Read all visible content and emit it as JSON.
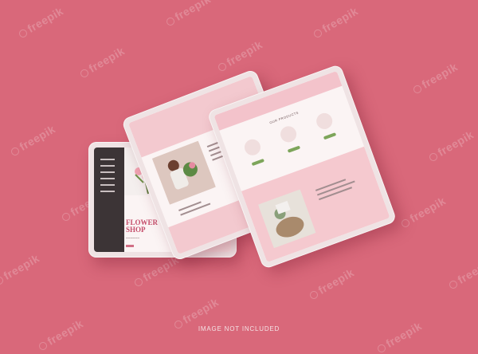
{
  "watermark": {
    "text": "freepik"
  },
  "mockup": {
    "left_tablet": {
      "title_line1": "FLOWER",
      "title_line2": "SHOP"
    },
    "right_tablet": {
      "heading": "OUR PRODUCTS"
    }
  },
  "footer": {
    "label": "IMAGE NOT INCLUDED"
  },
  "colors": {
    "background": "#d9687a",
    "accent_pink": "#f3c3cb",
    "accent_green": "#7da55a"
  }
}
